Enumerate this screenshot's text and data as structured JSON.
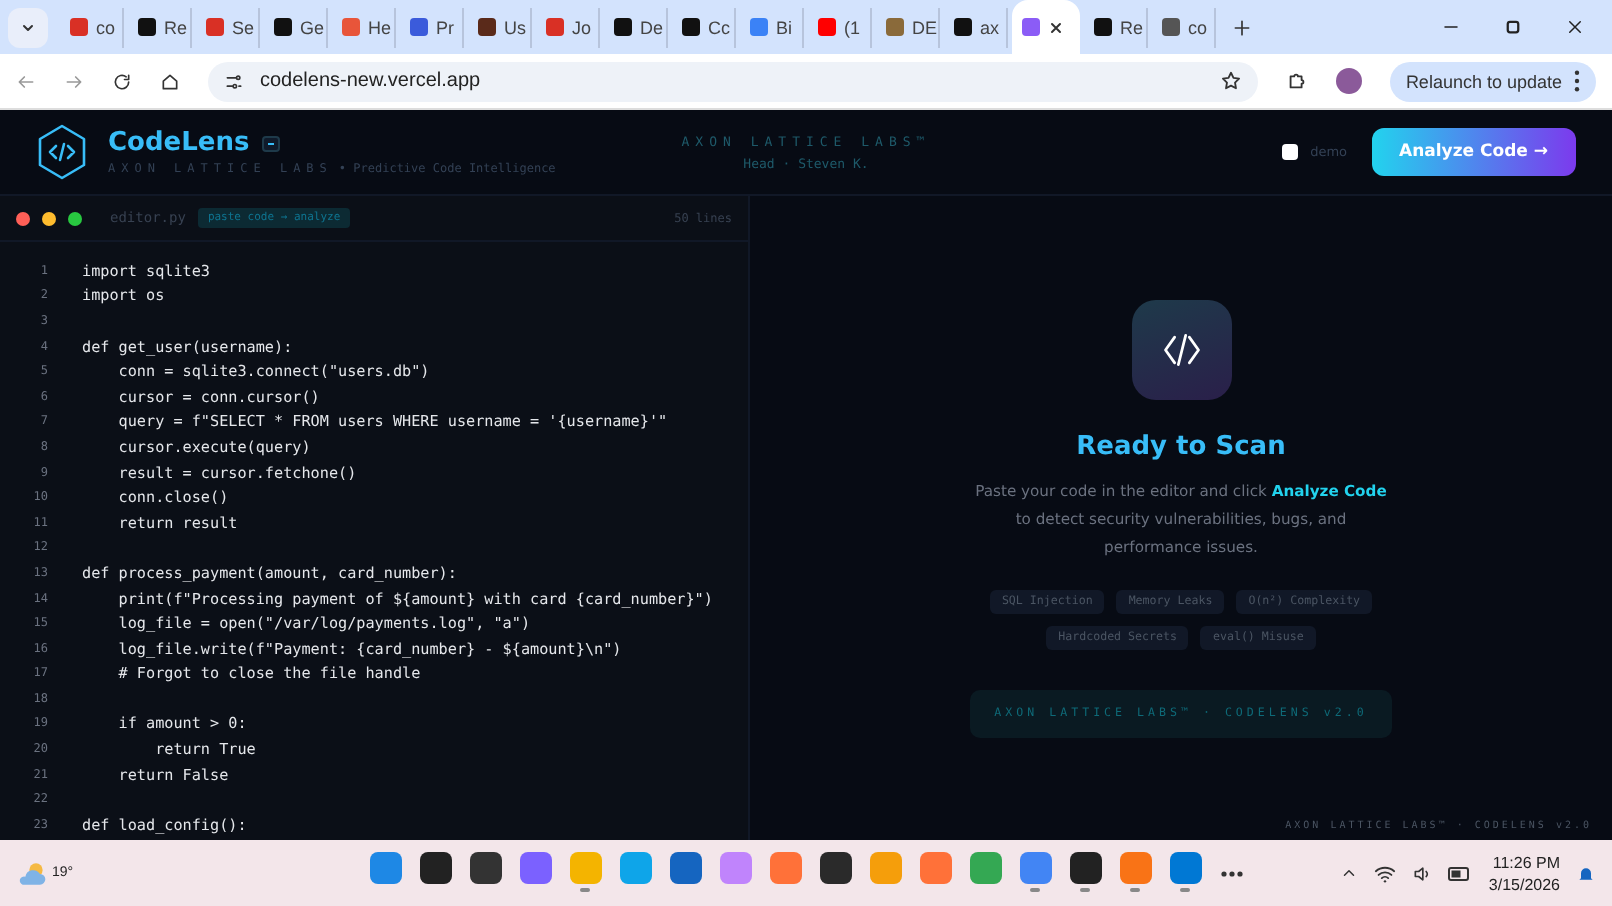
{
  "browser": {
    "tabs": [
      {
        "label": "co",
        "color": "#d93025",
        "selected": false
      },
      {
        "label": "Re",
        "color": "#111111",
        "selected": false
      },
      {
        "label": "Se",
        "color": "#d93025",
        "selected": false
      },
      {
        "label": "Ge",
        "color": "#111111",
        "selected": false
      },
      {
        "label": "He",
        "color": "#e8553a",
        "selected": false
      },
      {
        "label": "Pr",
        "color": "#3b5bdb",
        "selected": false
      },
      {
        "label": "Us",
        "color": "#5a2a1a",
        "selected": false
      },
      {
        "label": "Jo",
        "color": "#d93025",
        "selected": false
      },
      {
        "label": "De",
        "color": "#111111",
        "selected": false
      },
      {
        "label": "Cc",
        "color": "#111111",
        "selected": false
      },
      {
        "label": "Bi",
        "color": "#3b82f6",
        "selected": false
      },
      {
        "label": "(1",
        "color": "#ff0000",
        "selected": false
      },
      {
        "label": "DE",
        "color": "#8a6a3a",
        "selected": false
      },
      {
        "label": "ax",
        "color": "#111111",
        "selected": false
      },
      {
        "color": "#8b5cf6",
        "selected": true
      },
      {
        "label": "Re",
        "color": "#111111",
        "selected": false
      },
      {
        "label": "co",
        "color": "#555555",
        "selected": false
      }
    ],
    "url": "codelens-new.vercel.app",
    "update_button": "Relaunch to update"
  },
  "header": {
    "brand": "CodeLens",
    "brand_sub": "AXON LATTICE LABS",
    "tagline": "• Predictive Code Intelligence",
    "center_title": "AXON LATTICE LABS™",
    "center_sub": "Head · Steven K.",
    "demo": {
      "label": "demo",
      "checked": false
    },
    "analyze_button": "Analyze Code →"
  },
  "editor": {
    "filename": "editor.py",
    "badge": "paste code → analyze",
    "line_count": "50 lines",
    "lines": [
      {
        "number": "1",
        "code": "import sqlite3"
      },
      {
        "number": "2",
        "code": "import os"
      },
      {
        "number": "3"
      },
      {
        "number": "4",
        "code": "def get_user(username):"
      },
      {
        "number": "5",
        "code": "    conn = sqlite3.connect(\"users.db\")"
      },
      {
        "number": "6",
        "code": "    cursor = conn.cursor()"
      },
      {
        "number": "7",
        "code": "    query = f\"SELECT * FROM users WHERE username = '{username}'\""
      },
      {
        "number": "8",
        "code": "    cursor.execute(query)"
      },
      {
        "number": "9",
        "code": "    result = cursor.fetchone()"
      },
      {
        "number": "10",
        "code": "    conn.close()"
      },
      {
        "number": "11",
        "code": "    return result"
      },
      {
        "number": "12"
      },
      {
        "number": "13",
        "code": "def process_payment(amount, card_number):"
      },
      {
        "number": "14",
        "code": "    print(f\"Processing payment of ${amount} with card {card_number}\")"
      },
      {
        "number": "15",
        "code": "    log_file = open(\"/var/log/payments.log\", \"a\")"
      },
      {
        "number": "16",
        "code": "    log_file.write(f\"Payment: {card_number} - ${amount}\\n\")"
      },
      {
        "number": "17",
        "code": "    # Forgot to close the file handle"
      },
      {
        "number": "18"
      },
      {
        "number": "19",
        "code": "    if amount > 0:"
      },
      {
        "number": "20",
        "code": "        return True"
      },
      {
        "number": "21",
        "code": "    return False"
      },
      {
        "number": "22"
      },
      {
        "number": "23",
        "code": "def load_config():"
      }
    ]
  },
  "results": {
    "title": "Ready to Scan",
    "description": "Paste your code in the editor and click **Analyze Code** to detect security vulnerabilities, bugs, and performance issues.",
    "tags": [
      "SQL Injection",
      "Memory Leaks",
      "O(n²) Complexity",
      "Hardcoded Secrets",
      "eval() Misuse"
    ],
    "footer_badge": "AXON LATTICE LABS™ · CODELENS v2.0",
    "watermark": "AXON LATTICE LABS™ · CODELENS v2.0"
  },
  "taskbar": {
    "weather": "19°",
    "apps": [
      {
        "color": "#1e88e5",
        "running": false
      },
      {
        "color": "#222222",
        "running": false
      },
      {
        "color": "#333333",
        "running": false
      },
      {
        "color": "#7b61ff",
        "running": false
      },
      {
        "color": "#f4b400",
        "running": true
      },
      {
        "color": "#0ea5e9",
        "running": false
      },
      {
        "color": "#1565c0",
        "running": false
      },
      {
        "color": "#c084fc",
        "running": false
      },
      {
        "color": "#ff7139",
        "running": false
      },
      {
        "color": "#2a2a2a",
        "running": false
      },
      {
        "color": "#f59e0b",
        "running": false
      },
      {
        "color": "#ff7139",
        "running": false
      },
      {
        "color": "#34a853",
        "running": false
      },
      {
        "color": "#4285f4",
        "running": true
      },
      {
        "color": "#222222",
        "running": true
      },
      {
        "color": "#f97316",
        "running": true
      },
      {
        "color": "#0078d4",
        "running": true
      }
    ],
    "time": "11:26 PM",
    "date": "3/15/2026"
  }
}
